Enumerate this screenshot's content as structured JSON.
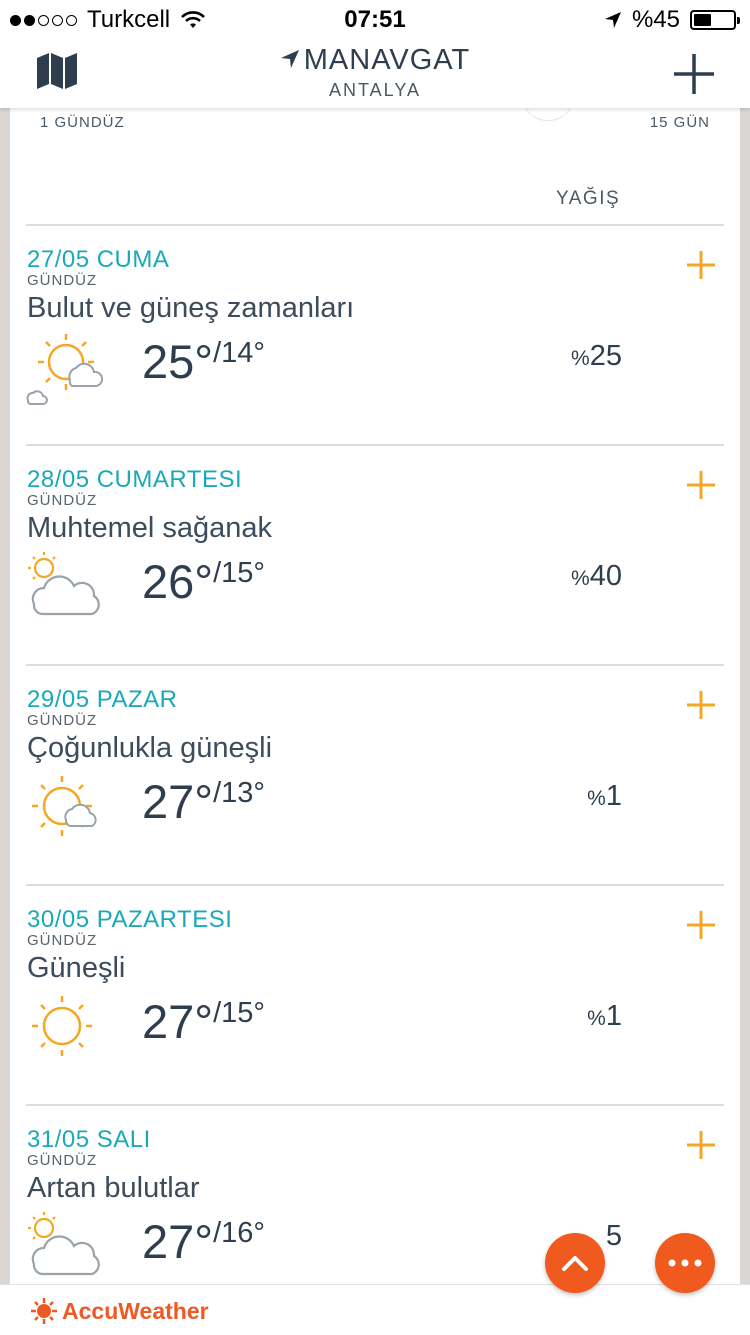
{
  "status_bar": {
    "carrier": "Turkcell",
    "time": "07:51",
    "battery": "%45",
    "battery_level": 0.45,
    "signal_bars_filled": 2,
    "signal_bars_total": 5
  },
  "header": {
    "location_name": "MANAVGAT",
    "location_region": "ANTALYA",
    "left_icon": "map-icon",
    "right_icon": "plus-icon"
  },
  "range": {
    "start_label": "1 GÜNDÜZ",
    "end_label": "15 GÜN"
  },
  "column_header": "YAĞIŞ",
  "days": [
    {
      "date": "27/05 CUMA",
      "period": "GÜNDÜZ",
      "description": "Bulut ve güneş zamanları",
      "high": "25°",
      "low": "/14°",
      "precip_prefix": "%",
      "precip_value": "25",
      "icon": "sun-cloud-icon"
    },
    {
      "date": "28/05 CUMARTESI",
      "period": "GÜNDÜZ",
      "description": "Muhtemel sağanak",
      "high": "26°",
      "low": "/15°",
      "precip_prefix": "%",
      "precip_value": "40",
      "icon": "cloud-sun-icon"
    },
    {
      "date": "29/05 PAZAR",
      "period": "GÜNDÜZ",
      "description": "Çoğunlukla güneşli",
      "high": "27°",
      "low": "/13°",
      "precip_prefix": "%",
      "precip_value": "1",
      "icon": "sun-small-cloud-icon"
    },
    {
      "date": "30/05 PAZARTESI",
      "period": "GÜNDÜZ",
      "description": "Güneşli",
      "high": "27°",
      "low": "/15°",
      "precip_prefix": "%",
      "precip_value": "1",
      "icon": "sun-icon"
    },
    {
      "date": "31/05 SALI",
      "period": "GÜNDÜZ",
      "description": "Artan bulutlar",
      "high": "27°",
      "low": "/16°",
      "precip_prefix": "",
      "precip_value": "5",
      "icon": "cloud-sun-icon"
    }
  ],
  "colors": {
    "accent_teal": "#1aa9b8",
    "accent_orange": "#f5a623",
    "brand_orange": "#f05a1e",
    "text_dark": "#2e3e4e"
  },
  "footer": {
    "brand": "AccuWeather"
  }
}
